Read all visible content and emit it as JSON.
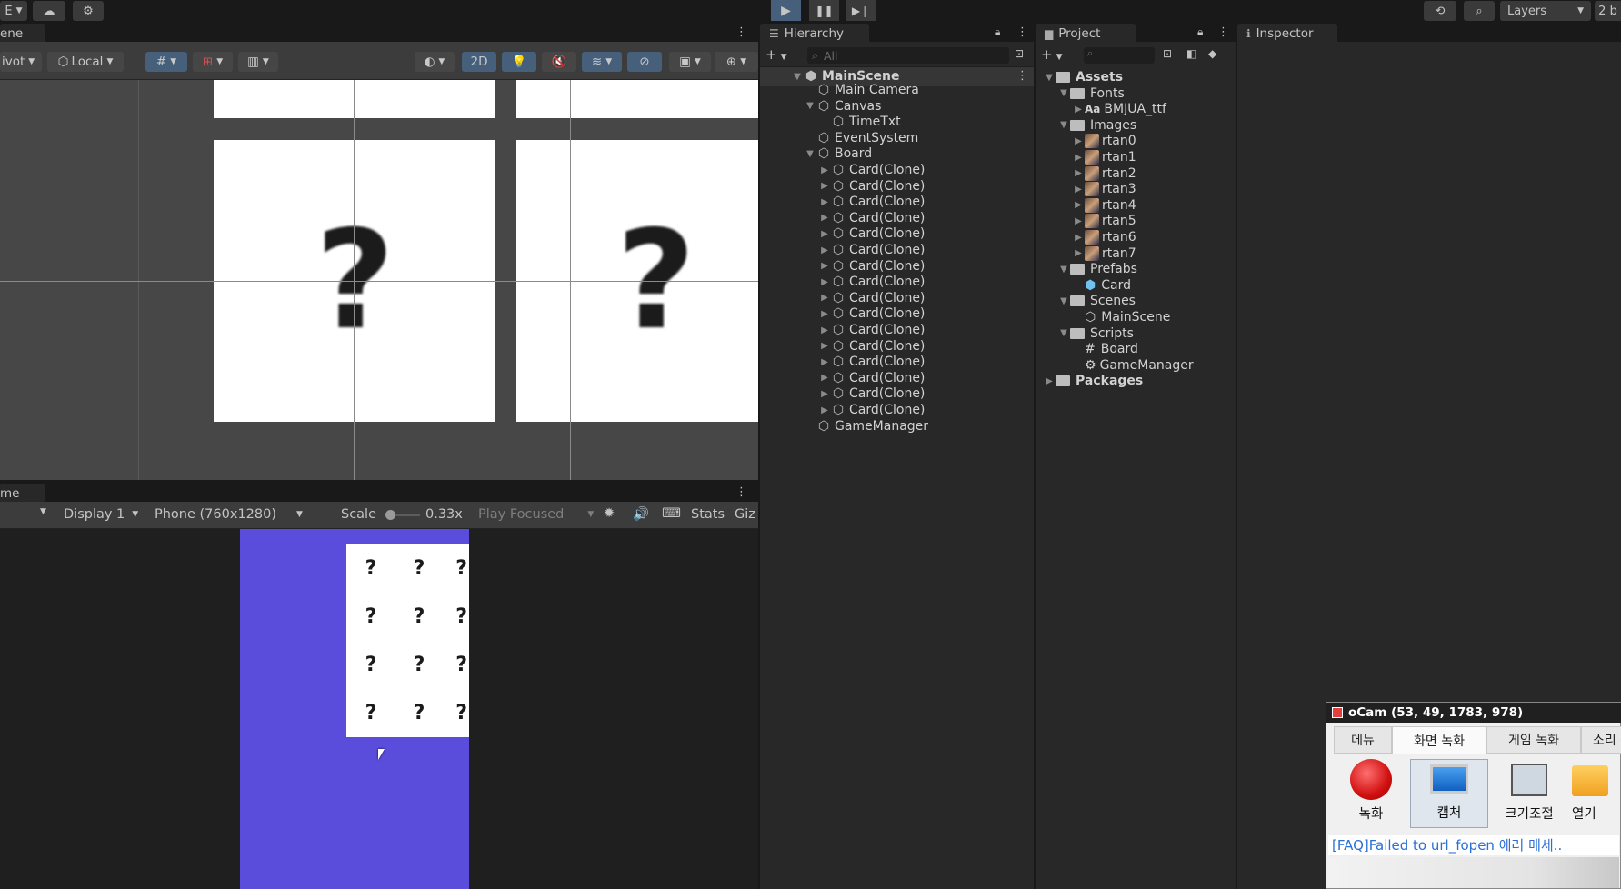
{
  "toolbar": {
    "left_menu": "E",
    "layers_label": "Layers",
    "right_partial": "2 b"
  },
  "scene": {
    "tab_label": "ene",
    "pivot_label": "ivot",
    "local_label": "Local",
    "mode_2d": "2D"
  },
  "game": {
    "tab_label": "me",
    "display_label": "Display 1",
    "resolution_label": "Phone (760x1280)",
    "scale_label": "Scale",
    "scale_value": "0.33x",
    "play_focused_label": "Play Focused",
    "stats_label": "Stats",
    "gizmos_label": "Giz",
    "card_symbol": "?"
  },
  "hierarchy": {
    "tab_label": "Hierarchy",
    "search_placeholder": "All",
    "scene_name": "MainScene",
    "items": [
      {
        "label": "Main Camera"
      },
      {
        "label": "Canvas"
      },
      {
        "label": "TimeTxt"
      },
      {
        "label": "EventSystem"
      },
      {
        "label": "Board"
      },
      {
        "label": "Card(Clone)"
      },
      {
        "label": "Card(Clone)"
      },
      {
        "label": "Card(Clone)"
      },
      {
        "label": "Card(Clone)"
      },
      {
        "label": "Card(Clone)"
      },
      {
        "label": "Card(Clone)"
      },
      {
        "label": "Card(Clone)"
      },
      {
        "label": "Card(Clone)"
      },
      {
        "label": "Card(Clone)"
      },
      {
        "label": "Card(Clone)"
      },
      {
        "label": "Card(Clone)"
      },
      {
        "label": "Card(Clone)"
      },
      {
        "label": "Card(Clone)"
      },
      {
        "label": "Card(Clone)"
      },
      {
        "label": "Card(Clone)"
      },
      {
        "label": "Card(Clone)"
      },
      {
        "label": "GameManager"
      }
    ]
  },
  "project": {
    "tab_label": "Project",
    "assets_label": "Assets",
    "items": [
      {
        "label": "Fonts"
      },
      {
        "label": "BMJUA_ttf",
        "prefix": "Aa"
      },
      {
        "label": "Images"
      },
      {
        "label": "rtan0"
      },
      {
        "label": "rtan1"
      },
      {
        "label": "rtan2"
      },
      {
        "label": "rtan3"
      },
      {
        "label": "rtan4"
      },
      {
        "label": "rtan5"
      },
      {
        "label": "rtan6"
      },
      {
        "label": "rtan7"
      },
      {
        "label": "Prefabs"
      },
      {
        "label": "Card"
      },
      {
        "label": "Scenes"
      },
      {
        "label": "MainScene"
      },
      {
        "label": "Scripts"
      },
      {
        "label": "Board"
      },
      {
        "label": "GameManager"
      }
    ],
    "packages_label": "Packages"
  },
  "inspector": {
    "tab_label": "Inspector"
  },
  "ocam": {
    "title": "oCam (53, 49, 1783, 978)",
    "tabs": [
      "메뉴",
      "화면 녹화",
      "게임 녹화",
      "소리 녹"
    ],
    "buttons": [
      "녹화",
      "캡처",
      "크기조절",
      "열기"
    ],
    "faq_text": "[FAQ]Failed to url_fopen 에러 메세.."
  },
  "colors": {
    "accent_play": "#46607c",
    "game_background": "#5b4ddb",
    "record_red": "#e02020"
  }
}
